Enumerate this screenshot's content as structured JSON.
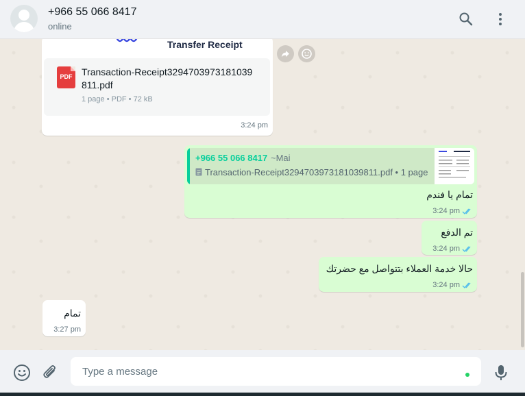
{
  "header": {
    "contact_name": "+966 55 066 8417",
    "status": "online",
    "icons": [
      "avatar",
      "search-icon",
      "menu-icon"
    ]
  },
  "messages": {
    "doc": {
      "preview_title": "Transfer Receipt",
      "file_name": "Transaction-Receipt3294703973181039811.pdf",
      "pdf_label": "PDF",
      "meta": "1 page • PDF • 72 kB",
      "time": "3:24 pm"
    },
    "reply": {
      "quote_author": "+966 55 066 8417",
      "quote_pushname": "~Mai",
      "quote_doc": "Transaction-Receipt3294703973181039811.pdf • 1 page",
      "text": "تمام يا فندم",
      "time": "3:24 pm"
    },
    "paid": {
      "text": "تم الدفع",
      "time": "3:24 pm"
    },
    "support": {
      "text": "حالا خدمة العملاء بتتواصل مع حضرتك",
      "time": "3:24 pm"
    },
    "incoming": {
      "text": "تمام",
      "time": "3:27 pm"
    }
  },
  "composer": {
    "placeholder": "Type a message",
    "icons": [
      "emoji-icon",
      "attach-icon",
      "mic-icon"
    ]
  },
  "colors": {
    "outgoing": "#d9fdd3",
    "incoming": "#ffffff",
    "accent": "#06cf9c",
    "read_ticks": "#53bdeb"
  }
}
